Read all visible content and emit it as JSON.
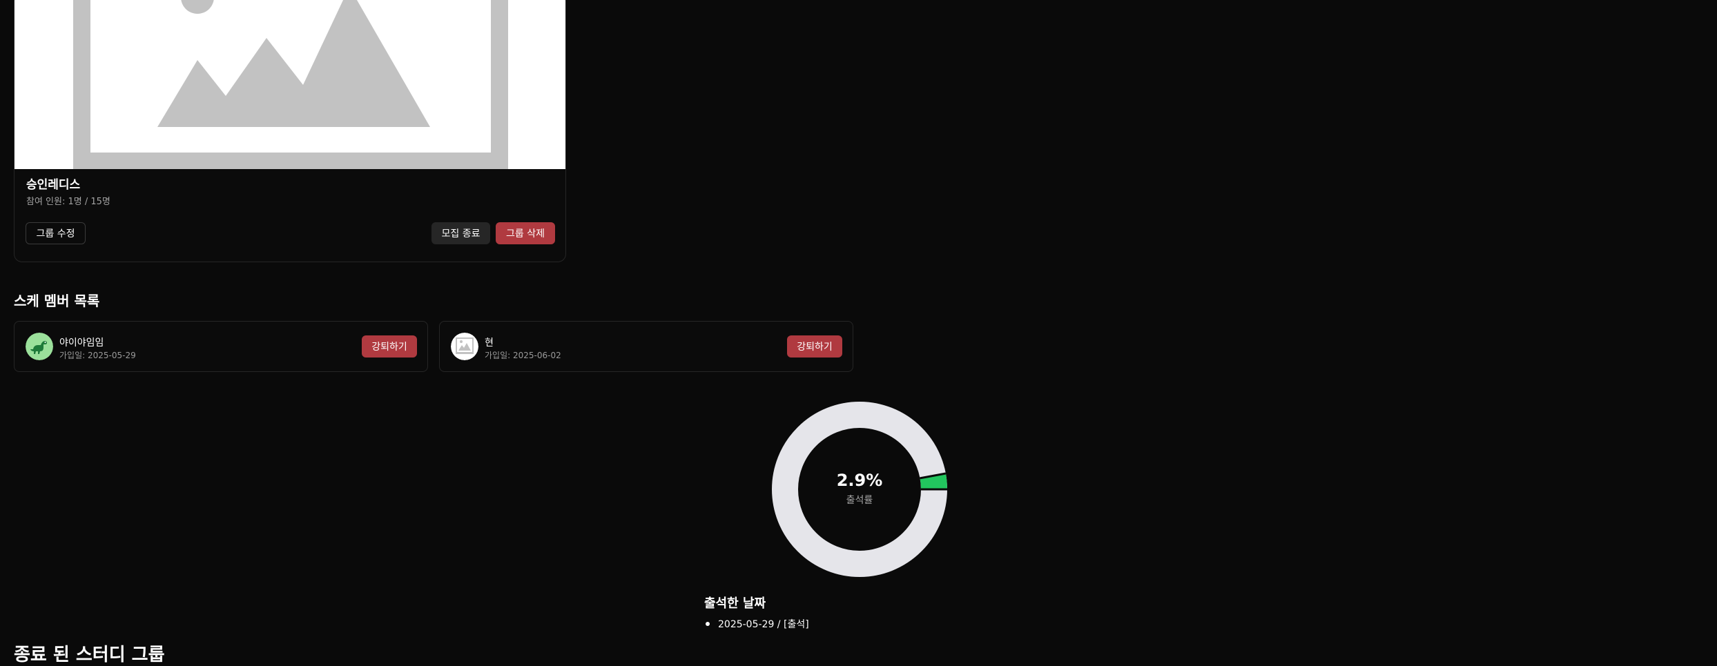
{
  "group": {
    "name": "승인레디스",
    "members_label": "참여 인원: 1명 / 15명",
    "edit_label": "그룹 수정",
    "close_recruit_label": "모집 종료",
    "delete_label": "그룹 삭제"
  },
  "members_section": {
    "title": "스케 멤버 목록",
    "members": [
      {
        "name": "야이야임임",
        "joined": "가입일: 2025-05-29",
        "kick_label": "강퇴하기",
        "avatar": "dinosaur-avatar-icon"
      },
      {
        "name": "현",
        "joined": "가입일: 2025-06-02",
        "kick_label": "강퇴하기",
        "avatar": "image-placeholder-avatar-icon"
      }
    ]
  },
  "attendance": {
    "rate_text": "2.9%",
    "rate_label": "출석률",
    "rate_value": 2.9,
    "colors": {
      "attended": "#22c55e",
      "remaining": "#e5e5ea"
    },
    "dates_title": "출석한 날짜",
    "dates": [
      "2025-05-29 / [출석]"
    ]
  },
  "ended_section": {
    "title": "종료 된 스터디 그룹"
  }
}
